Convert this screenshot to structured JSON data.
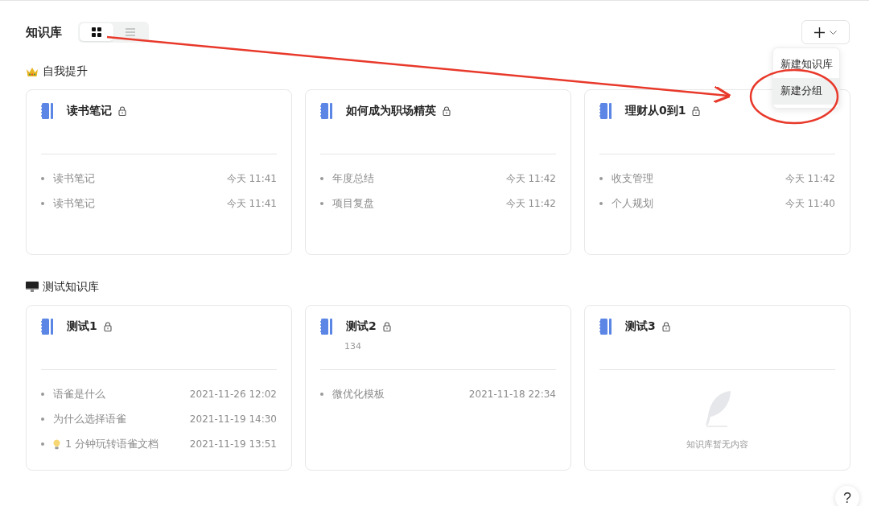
{
  "header": {
    "title": "知识库",
    "view_toggle": [
      {
        "kind": "grid",
        "selected": true
      },
      {
        "kind": "list",
        "selected": false
      }
    ]
  },
  "add_menu": {
    "items": [
      {
        "label": "新建知识库",
        "selected": false
      },
      {
        "label": "新建分组",
        "selected": true
      }
    ]
  },
  "groups": [
    {
      "kind": "crown",
      "title": "自我提升",
      "books": [
        {
          "title": "读书笔记",
          "docs": [
            {
              "title": "读书笔记",
              "time": "今天 11:41"
            },
            {
              "title": "读书笔记",
              "time": "今天 11:41"
            }
          ]
        },
        {
          "title": "如何成为职场精英",
          "docs": [
            {
              "title": "年度总结",
              "time": "今天 11:42"
            },
            {
              "title": "项目复盘",
              "time": "今天 11:42"
            }
          ]
        },
        {
          "title": "理财从0到1",
          "docs": [
            {
              "title": "收支管理",
              "time": "今天 11:42"
            },
            {
              "title": "个人规划",
              "time": "今天 11:40"
            }
          ]
        }
      ]
    },
    {
      "kind": "monitor",
      "title": "测试知识库",
      "books": [
        {
          "title": "测试1",
          "docs": [
            {
              "title": "语雀是什么",
              "time": "2021-11-26 12:02"
            },
            {
              "title": "为什么选择语雀",
              "time": "2021-11-19 14:30"
            },
            {
              "kind": "bulb",
              "title": "1 分钟玩转语雀文档",
              "time": "2021-11-19 13:51"
            }
          ]
        },
        {
          "title": "测试2",
          "description": "134",
          "docs": [
            {
              "title": "微优化模板",
              "time": "2021-11-18 22:34"
            }
          ]
        },
        {
          "title": "测试3",
          "empty_text": "知识库暂无内容"
        }
      ]
    }
  ],
  "help": {
    "label": "?"
  }
}
